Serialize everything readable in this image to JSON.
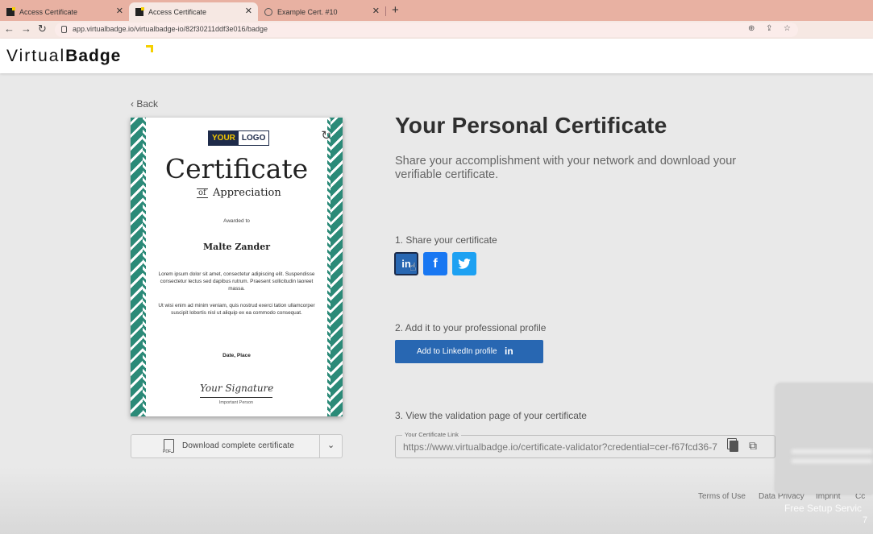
{
  "browser": {
    "tabs": [
      {
        "title": "Access Certificate",
        "active": false
      },
      {
        "title": "Access Certificate",
        "active": true
      },
      {
        "title": "Example Cert. #10",
        "active": false
      }
    ],
    "url": "app.virtualbadge.io/virtualbadge-io/82f30211ddf3e016/badge"
  },
  "header": {
    "brand_light": "Virtual",
    "brand_bold": "Badge"
  },
  "nav": {
    "back_label": "Back"
  },
  "certificate": {
    "logo_part1": "YOUR",
    "logo_part2": "LOGO",
    "title": "Certificate",
    "of": "of",
    "subtitle": "Appreciation",
    "awarded_to": "Awarded to",
    "recipient": "Malte Zander",
    "paragraph1": "Lorem ipsum dolor sit amet, consectetur adipiscing elit. Suspendisse consectetur lectus sed dapibus rutrum. Praesent sollicitudin laoreet massa.",
    "paragraph2": "Ut wisi enim ad minim veniam, quis nostrud exerci tation ullamcorper suscipit lobortis nisl ut aliquip ex ea commodo consequat.",
    "date_place": "Date, Place",
    "signature": "Your Signature",
    "signer_role": "Important Person"
  },
  "download": {
    "pdf_badge": "PDF",
    "label": "Download complete certificate"
  },
  "main": {
    "heading": "Your Personal Certificate",
    "subtitle": "Share your accomplishment with your network and download your verifiable certificate.",
    "step1": "1. Share your certificate",
    "step2": "2. Add it to your professional profile",
    "step3": "3. View the validation page of your certificate",
    "add_linkedin_label": "Add to LinkedIn profile",
    "linkedin_glyph": "in",
    "facebook_glyph": "f",
    "link_legend": "Your Certificate Link",
    "link_url": "https://www.virtualbadge.io/certificate-validator?credential=cer-f67fcd36-7"
  },
  "footer": {
    "terms": "Terms of Use",
    "privacy": "Data Privacy",
    "imprint": "Imprint",
    "cookies": "Cc"
  },
  "overlay": {
    "free_setup": "Free Setup Servic",
    "partial": "7"
  },
  "colors": {
    "linkedin": "#2867b2",
    "facebook": "#1877f2",
    "twitter": "#1da1f2",
    "brand_yellow": "#f5d000",
    "cert_border": "#2b8a78"
  }
}
